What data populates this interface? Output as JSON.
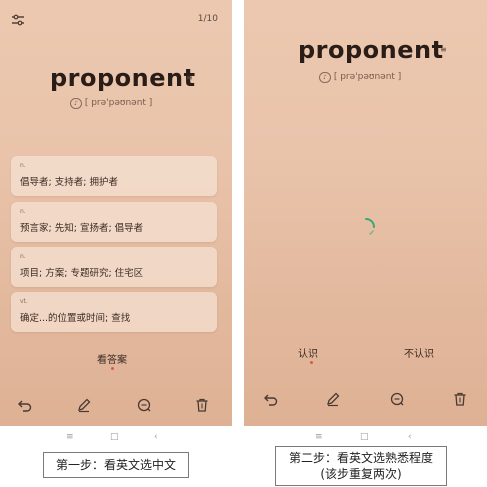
{
  "left": {
    "counter": "1/10",
    "word": "proponent",
    "phonetic": "[ prə'pəʊnənt ]",
    "cards": [
      {
        "pos": "n.",
        "definition": "倡导者; 支持者; 拥护者"
      },
      {
        "pos": "n.",
        "definition": "预言家; 先知; 宣扬者; 倡导者"
      },
      {
        "pos": "n.",
        "definition": "项目; 方案; 专题研究; 住宅区"
      },
      {
        "pos": "vt.",
        "definition": "确定...的位置或时间; 查找"
      }
    ],
    "show_answer": "看答案"
  },
  "right": {
    "word": "proponent",
    "phonetic": "[ prə'pəʊnənt ]",
    "know": "认识",
    "dont_know": "不认识"
  },
  "captions": {
    "step1": "第一步：看英文选中文",
    "step2_line1": "第二步：看英文选熟悉程度",
    "step2_line2": "(该步重复两次)"
  },
  "icons": {
    "settings": "sliders-icon",
    "undo": "undo-icon",
    "edit": "pencil-icon",
    "search": "search-icon",
    "delete": "trash-icon"
  },
  "colors": {
    "background_top": "#ecc8b0",
    "background_bottom": "#deb194",
    "spinner": "#3aa776",
    "accent_dot": "#e05a3a"
  }
}
